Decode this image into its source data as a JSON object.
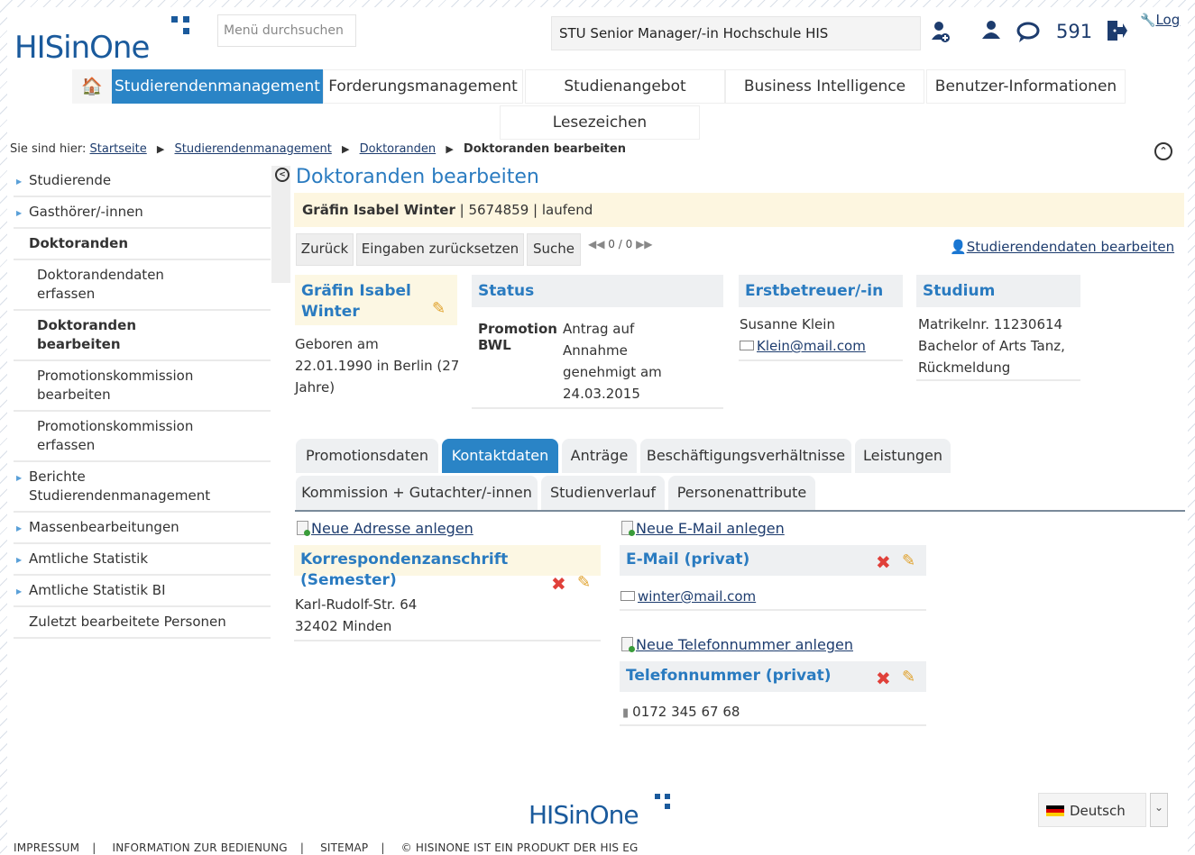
{
  "header": {
    "logo_text": "HISinOne",
    "menu_search_placeholder": "Menü durchsuchen",
    "role": "STU Senior Manager/-in Hochschule HIS",
    "message_count": "591",
    "log_label": "Log"
  },
  "nav": {
    "items": [
      {
        "label": "Studierendenmanagement"
      },
      {
        "label": "Forderungsmanagement"
      },
      {
        "label": "Studienangebot"
      },
      {
        "label": "Business Intelligence"
      },
      {
        "label": "Benutzer-Informationen"
      },
      {
        "label": "Lesezeichen"
      }
    ]
  },
  "breadcrumb": {
    "prefix": "Sie sind hier:",
    "items": [
      "Startseite",
      "Studierendenmanagement",
      "Doktoranden",
      "Doktoranden bearbeiten"
    ]
  },
  "sidebar": {
    "items": [
      {
        "label": "Studierende"
      },
      {
        "label": "Gasthörer/-innen"
      },
      {
        "label": "Doktoranden"
      },
      {
        "label": "Doktorandendaten erfassen"
      },
      {
        "label": "Doktoranden bearbeiten"
      },
      {
        "label": "Promotionskommission bearbeiten"
      },
      {
        "label": "Promotionskommission erfassen"
      },
      {
        "label": "Berichte Studierendenmanagement"
      },
      {
        "label": "Massenbearbeitungen"
      },
      {
        "label": "Amtliche Statistik"
      },
      {
        "label": "Amtliche Statistik BI"
      },
      {
        "label": "Zuletzt bearbeitete Personen"
      }
    ]
  },
  "main": {
    "title": "Doktoranden bearbeiten",
    "person_name": "Gräfin Isabel Winter",
    "person_number": "5674859",
    "person_state": "laufend",
    "buttons": {
      "back": "Zurück",
      "reset": "Eingaben zurücksetzen",
      "search": "Suche"
    },
    "pager": "0 / 0",
    "edit_student_link": "Studierendendaten bearbeiten"
  },
  "cards": {
    "person": {
      "name_line1": "Gräfin Isabel",
      "name_line2": "Winter",
      "born_label": "Geboren am",
      "born_value": "22.01.1990 in Berlin (27",
      "born_value2": "Jahre)"
    },
    "status": {
      "title": "Status",
      "label_line1": "Promotion",
      "label_line2": "BWL",
      "value_line1": "Antrag auf",
      "value_line2": "Annahme",
      "value_line3": "genehmigt am",
      "value_line4": "24.03.2015"
    },
    "supervisor": {
      "title": "Erstbetreuer/-in",
      "name": "Susanne Klein",
      "email": "Klein@mail.com"
    },
    "study": {
      "title": "Studium",
      "line1": "Matrikelnr. 11230614",
      "line2": "Bachelor of Arts Tanz,",
      "line3": "Rückmeldung"
    }
  },
  "tabs": {
    "row1": [
      "Promotionsdaten",
      "Kontaktdaten",
      "Anträge",
      "Beschäftigungsverhältnisse",
      "Leistungen"
    ],
    "row2": [
      "Kommission + Gutachter/-innen",
      "Studienverlauf",
      "Personenattribute"
    ],
    "active": "Kontaktdaten"
  },
  "contact": {
    "new_address": "Neue Adresse anlegen",
    "address_title": "Korrespondenzanschrift (Semester)",
    "address_line1": "Karl-Rudolf-Str. 64",
    "address_line2": "32402 Minden",
    "new_email": "Neue E-Mail anlegen",
    "email_title": "E-Mail (privat)",
    "email_value": "winter@mail.com",
    "new_phone": "Neue Telefonnummer anlegen",
    "phone_title": "Telefonnummer (privat)",
    "phone_value": "0172 345 67 68"
  },
  "footer": {
    "logo_text": "HISinOne",
    "language": "Deutsch",
    "links": [
      "IMPRESSUM",
      "INFORMATION ZUR BEDIENUNG",
      "SITEMAP",
      "© HISINONE IST EIN PRODUKT DER HIS EG"
    ]
  },
  "colors": {
    "accent": "#2a84c6",
    "title_blue": "#2a7bc0",
    "link": "#1d3c6e",
    "highlight": "#fdf6e0"
  }
}
